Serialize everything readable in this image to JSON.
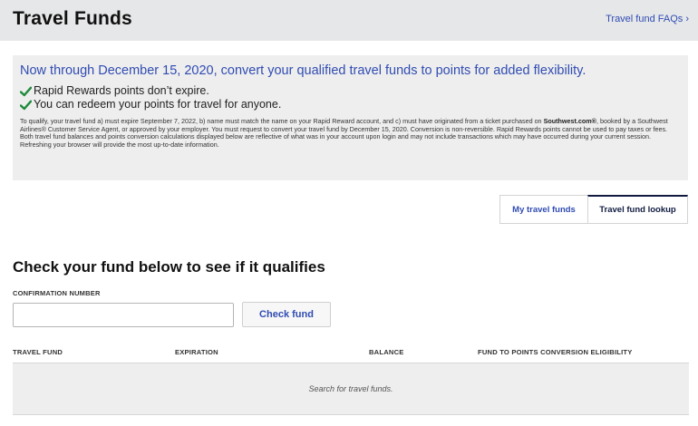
{
  "header": {
    "title": "Travel Funds",
    "faq_link": "Travel fund FAQs ›"
  },
  "promo": {
    "headline": "Now through December 15, 2020, convert your qualified travel funds to points for added flexibility.",
    "items": [
      "Rapid Rewards points don’t expire.",
      "You can redeem your points for travel for anyone."
    ],
    "fine_print_1": "To qualify, your travel fund a) must expire September 7, 2022, b) name must match the name on your Rapid Reward account, and c) must have originated from a ticket purchased on ",
    "fine_print_bold": "Southwest.com®",
    "fine_print_2": ", booked by a Southwest Airlines® Customer Service Agent, or approved by your employer. You must request to convert your travel fund by December 15, 2020. Conversion is non-reversible. Rapid Rewards points cannot be used to pay taxes or fees. Both travel fund balances and points conversion calculations displayed below are reflective of what was in your account upon login and may not include transactions which may have occurred during your current session. Refreshing your browser will provide the most up-to-date information."
  },
  "tabs": [
    {
      "label": "My travel funds",
      "active": false
    },
    {
      "label": "Travel fund lookup",
      "active": true
    }
  ],
  "form": {
    "heading": "Check your fund below to see if it qualifies",
    "confirmation_label": "CONFIRMATION NUMBER",
    "confirmation_value": "",
    "button_label": "Check fund"
  },
  "table": {
    "columns": [
      "TRAVEL FUND",
      "EXPIRATION",
      "BALANCE",
      "FUND TO POINTS CONVERSION ELIGIBILITY"
    ],
    "empty_message": "Search for travel funds."
  },
  "colors": {
    "brand_blue": "#304cb2",
    "check_green": "#1e8a3b",
    "navy": "#111b40"
  },
  "icons": {
    "check": "check-icon"
  }
}
